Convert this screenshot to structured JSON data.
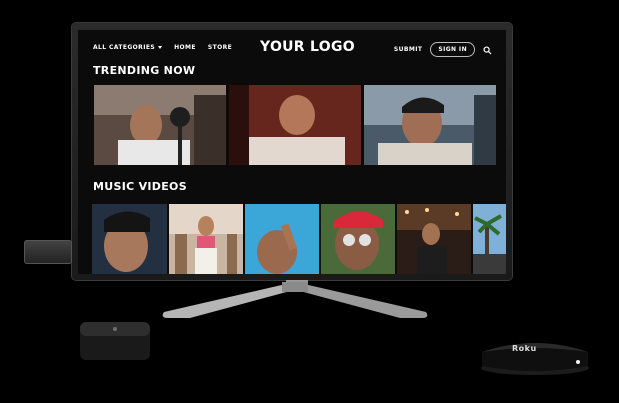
{
  "nav": {
    "all_categories": "ALL CATEGORIES",
    "home": "HOME",
    "store": "STORE",
    "logo": "YOUR LOGO",
    "submit": "SUBMIT",
    "sign_in": "SIGN IN"
  },
  "sections": {
    "trending": "TRENDING NOW",
    "music_videos": "MUSIC VIDEOS"
  },
  "devices": {
    "roku_label": "Roku"
  },
  "colors": {
    "screen_bg": "#0b0b0b",
    "text": "#ffffff",
    "bezel": "#1f1f1f"
  },
  "icons": [
    "search-icon",
    "chevron-down-icon"
  ]
}
